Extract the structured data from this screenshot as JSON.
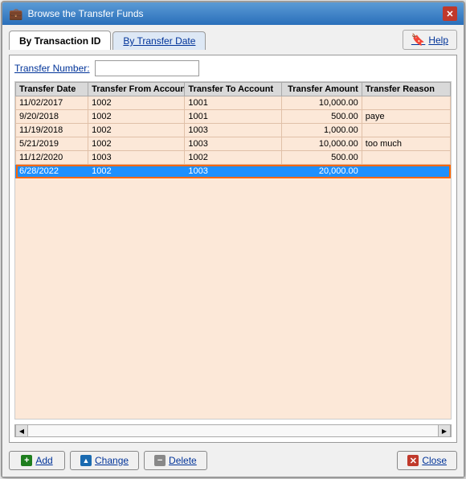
{
  "window": {
    "title": "Browse the Transfer Funds",
    "title_icon": "💼"
  },
  "tabs": [
    {
      "id": "by-transaction-id",
      "label": "By Transaction ID",
      "active": true
    },
    {
      "id": "by-transfer-date",
      "label": "By Transfer Date",
      "active": false
    }
  ],
  "help_button": "Help",
  "transfer_number_label": "Transfer Number:",
  "transfer_number_value": "",
  "table": {
    "columns": [
      {
        "id": "date",
        "label": "Transfer Date"
      },
      {
        "id": "from",
        "label": "Transfer From Account"
      },
      {
        "id": "to",
        "label": "Transfer To Account"
      },
      {
        "id": "amount",
        "label": "Transfer Amount"
      },
      {
        "id": "reason",
        "label": "Transfer Reason"
      }
    ],
    "rows": [
      {
        "date": "11/02/2017",
        "from": "1002",
        "to": "1001",
        "amount": "10,000.00",
        "reason": "",
        "selected": false
      },
      {
        "date": "9/20/2018",
        "from": "1002",
        "to": "1001",
        "amount": "500.00",
        "reason": "paye",
        "selected": false
      },
      {
        "date": "11/19/2018",
        "from": "1002",
        "to": "1003",
        "amount": "1,000.00",
        "reason": "",
        "selected": false
      },
      {
        "date": "5/21/2019",
        "from": "1002",
        "to": "1003",
        "amount": "10,000.00",
        "reason": "too much",
        "selected": false
      },
      {
        "date": "11/12/2020",
        "from": "1003",
        "to": "1002",
        "amount": "500.00",
        "reason": "",
        "selected": false
      },
      {
        "date": "6/28/2022",
        "from": "1002",
        "to": "1003",
        "amount": "20,000.00",
        "reason": "",
        "selected": true
      }
    ]
  },
  "buttons": {
    "add": "Add",
    "change": "Change",
    "delete": "Delete",
    "close": "Close"
  }
}
